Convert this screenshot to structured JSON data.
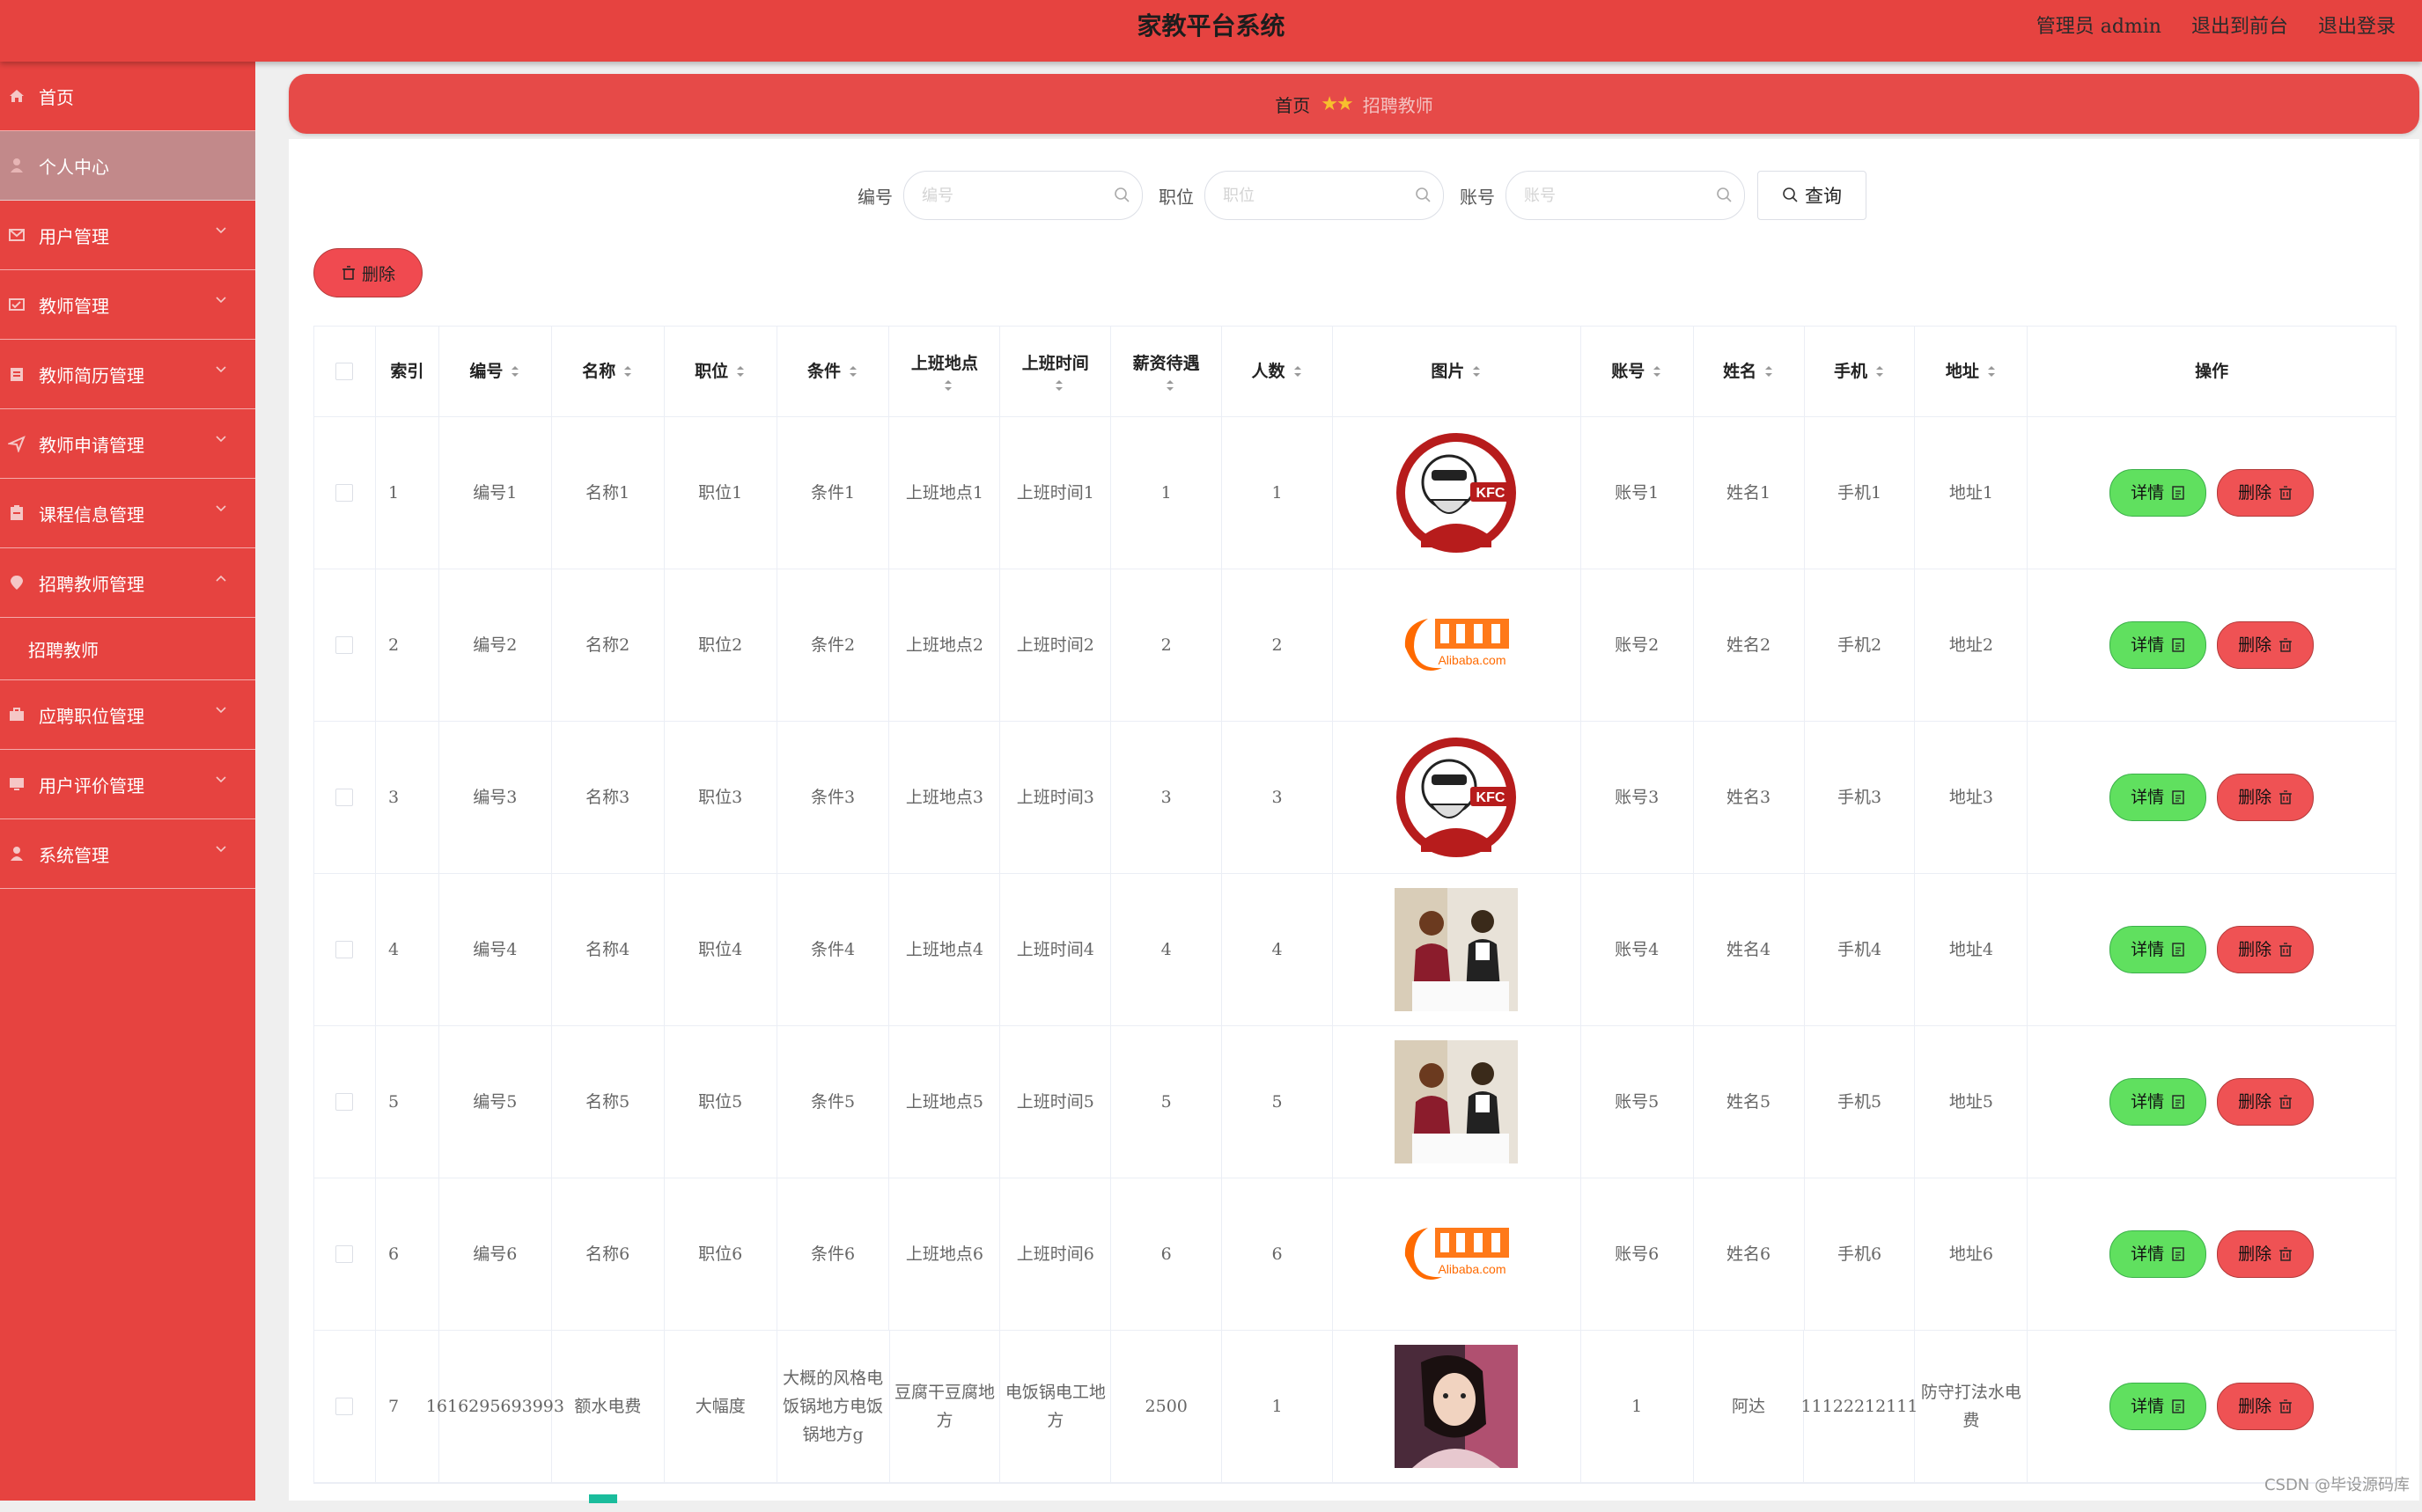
{
  "header": {
    "title": "家教平台系统",
    "links": [
      "管理员 admin",
      "退出到前台",
      "退出登录"
    ]
  },
  "sidebar": {
    "items": [
      {
        "label": "首页",
        "icon": "home-icon"
      },
      {
        "label": "个人中心",
        "icon": "user-icon",
        "active": true
      },
      {
        "label": "用户管理",
        "icon": "mail-icon"
      },
      {
        "label": "教师管理",
        "icon": "card-icon"
      },
      {
        "label": "教师简历管理",
        "icon": "document-icon"
      },
      {
        "label": "教师申请管理",
        "icon": "send-icon"
      },
      {
        "label": "课程信息管理",
        "icon": "clipboard-icon"
      },
      {
        "label": "招聘教师管理",
        "icon": "location-icon",
        "expanded": true
      },
      {
        "label": "应聘职位管理",
        "icon": "briefcase-icon"
      },
      {
        "label": "用户评价管理",
        "icon": "monitor-icon"
      },
      {
        "label": "系统管理",
        "icon": "person-icon"
      }
    ],
    "subitem": "招聘教师"
  },
  "breadcrumb": {
    "home": "首页",
    "current": "招聘教师"
  },
  "search": {
    "fields": [
      {
        "label": "编号",
        "placeholder": "编号"
      },
      {
        "label": "职位",
        "placeholder": "职位"
      },
      {
        "label": "账号",
        "placeholder": "账号"
      }
    ],
    "query_label": "查询"
  },
  "toolbar": {
    "delete_label": "删除"
  },
  "table": {
    "headers": {
      "index": "索引",
      "code": "编号",
      "name": "名称",
      "position": "职位",
      "condition": "条件",
      "work_place": "上班地点",
      "work_time": "上班时间",
      "salary": "薪资待遇",
      "count": "人数",
      "image": "图片",
      "account": "账号",
      "realname": "姓名",
      "phone": "手机",
      "address": "地址",
      "ops": "操作"
    },
    "rows": [
      {
        "index": "1",
        "code": "编号1",
        "name": "名称1",
        "position": "职位1",
        "condition": "条件1",
        "work_place": "上班地点1",
        "work_time": "上班时间1",
        "salary": "1",
        "count": "1",
        "image": "kfc-logo",
        "account": "账号1",
        "realname": "姓名1",
        "phone": "手机1",
        "address": "地址1"
      },
      {
        "index": "2",
        "code": "编号2",
        "name": "名称2",
        "position": "职位2",
        "condition": "条件2",
        "work_place": "上班地点2",
        "work_time": "上班时间2",
        "salary": "2",
        "count": "2",
        "image": "alibaba-logo",
        "account": "账号2",
        "realname": "姓名2",
        "phone": "手机2",
        "address": "地址2"
      },
      {
        "index": "3",
        "code": "编号3",
        "name": "名称3",
        "position": "职位3",
        "condition": "条件3",
        "work_place": "上班地点3",
        "work_time": "上班时间3",
        "salary": "3",
        "count": "3",
        "image": "kfc-logo",
        "account": "账号3",
        "realname": "姓名3",
        "phone": "手机3",
        "address": "地址3"
      },
      {
        "index": "4",
        "code": "编号4",
        "name": "名称4",
        "position": "职位4",
        "condition": "条件4",
        "work_place": "上班地点4",
        "work_time": "上班时间4",
        "salary": "4",
        "count": "4",
        "image": "interview-photo",
        "account": "账号4",
        "realname": "姓名4",
        "phone": "手机4",
        "address": "地址4"
      },
      {
        "index": "5",
        "code": "编号5",
        "name": "名称5",
        "position": "职位5",
        "condition": "条件5",
        "work_place": "上班地点5",
        "work_time": "上班时间5",
        "salary": "5",
        "count": "5",
        "image": "interview-photo",
        "account": "账号5",
        "realname": "姓名5",
        "phone": "手机5",
        "address": "地址5"
      },
      {
        "index": "6",
        "code": "编号6",
        "name": "名称6",
        "position": "职位6",
        "condition": "条件6",
        "work_place": "上班地点6",
        "work_time": "上班时间6",
        "salary": "6",
        "count": "6",
        "image": "alibaba-logo",
        "account": "账号6",
        "realname": "姓名6",
        "phone": "手机6",
        "address": "地址6"
      },
      {
        "index": "7",
        "code": "1616295693993",
        "name": "额水电费",
        "position": "大幅度",
        "condition": "大概的风格电饭锅地方电饭锅地方g",
        "work_place": "豆腐干豆腐地方",
        "work_time": "电饭锅电工地方",
        "salary": "2500",
        "count": "1",
        "image": "portrait-photo",
        "account": "1",
        "realname": "阿达",
        "phone": "11122212111",
        "address": "防守打法水电费"
      }
    ],
    "detail_label": "详情",
    "delete_label": "删除"
  },
  "watermark": "CSDN @毕设源码库",
  "colors": {
    "primary": "#e64340",
    "detail": "#60e05f",
    "delete": "#ef5254",
    "accent": "#1abc9c"
  }
}
